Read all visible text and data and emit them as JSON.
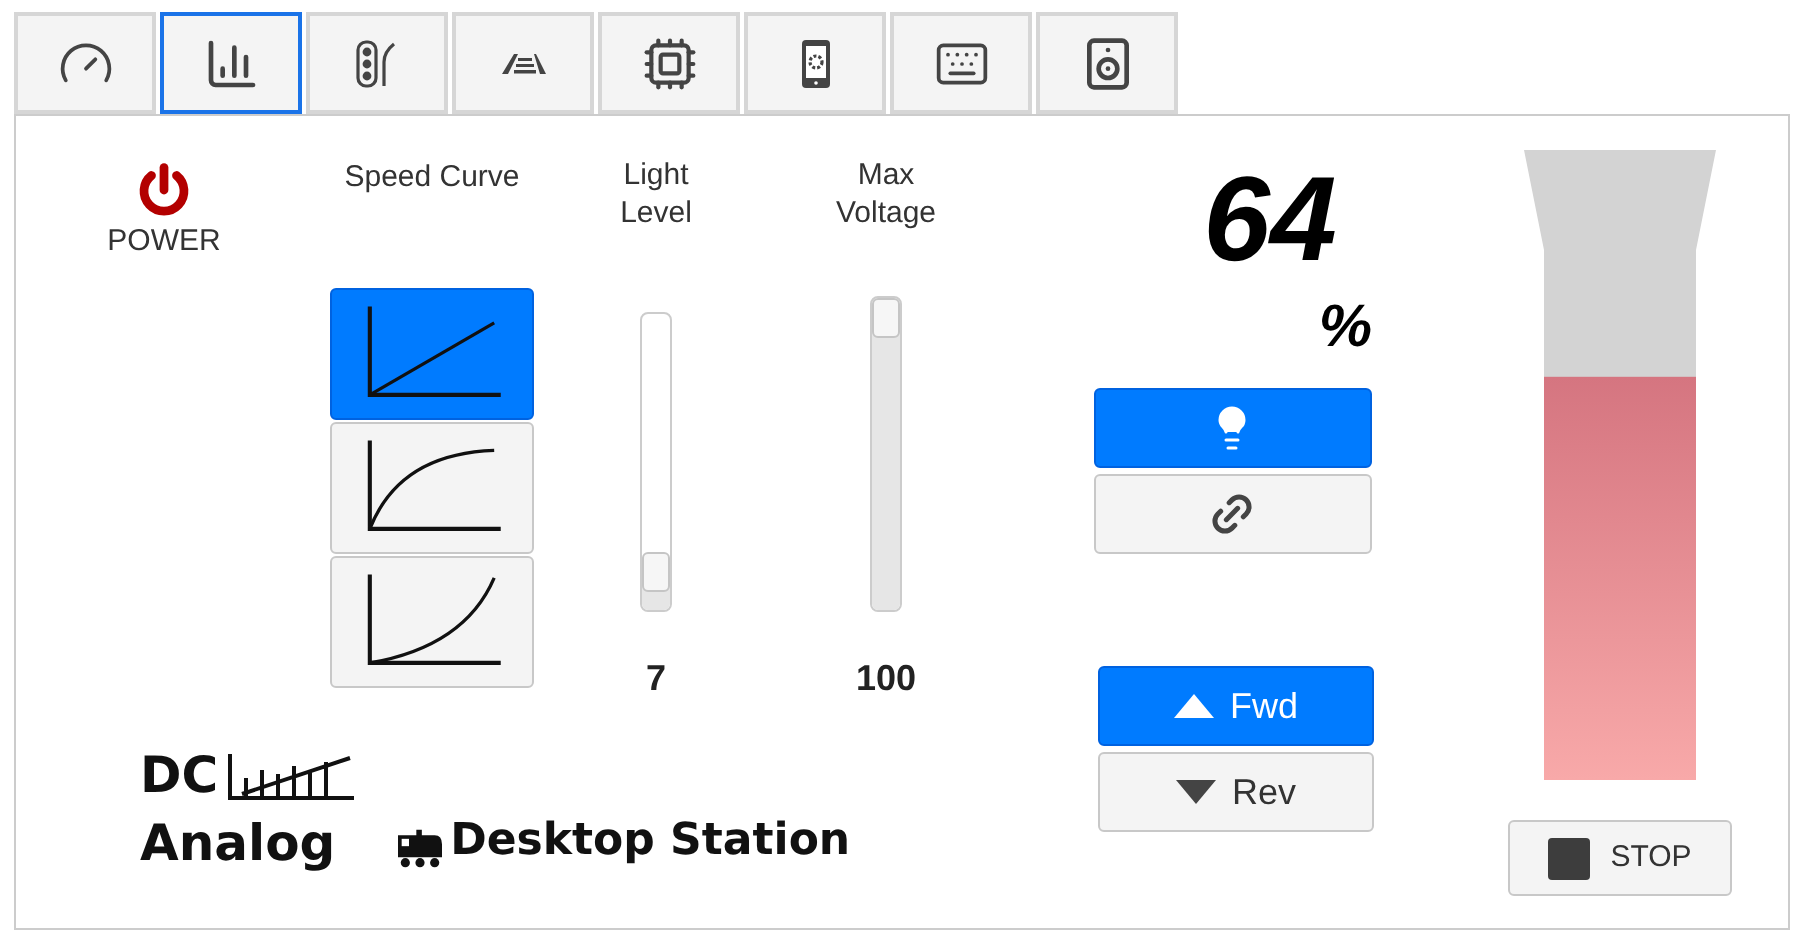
{
  "tabs": [
    {
      "kind": "gauge",
      "selected": false
    },
    {
      "kind": "chart",
      "selected": true
    },
    {
      "kind": "signal",
      "selected": false
    },
    {
      "kind": "track",
      "selected": false
    },
    {
      "kind": "chip",
      "selected": false
    },
    {
      "kind": "tablet",
      "selected": false
    },
    {
      "kind": "keyboard",
      "selected": false
    },
    {
      "kind": "speaker",
      "selected": false
    }
  ],
  "power": {
    "label": "POWER"
  },
  "speed_curve": {
    "label": "Speed Curve",
    "options": [
      {
        "kind": "linear",
        "selected": true
      },
      {
        "kind": "concave",
        "selected": false
      },
      {
        "kind": "convex",
        "selected": false
      }
    ]
  },
  "sliders": [
    {
      "label": "Light Level",
      "level": 0.07,
      "reading": "7"
    },
    {
      "label": "Max Voltage",
      "level": 1,
      "reading": "100"
    }
  ],
  "speed": {
    "value": "64",
    "unit": "%"
  },
  "toggles": [
    {
      "kind": "light",
      "selected": true
    },
    {
      "kind": "link",
      "selected": false
    }
  ],
  "direction": [
    {
      "kind": "up",
      "label": "Fwd",
      "selected": true
    },
    {
      "kind": "down",
      "label": "Rev",
      "selected": false
    }
  ],
  "meter": {
    "level": 0.64
  },
  "stop_button": {
    "label": "STOP"
  },
  "logo": {
    "line_1": "DC",
    "line_2": "Analog",
    "brand": "Desktop Station"
  }
}
